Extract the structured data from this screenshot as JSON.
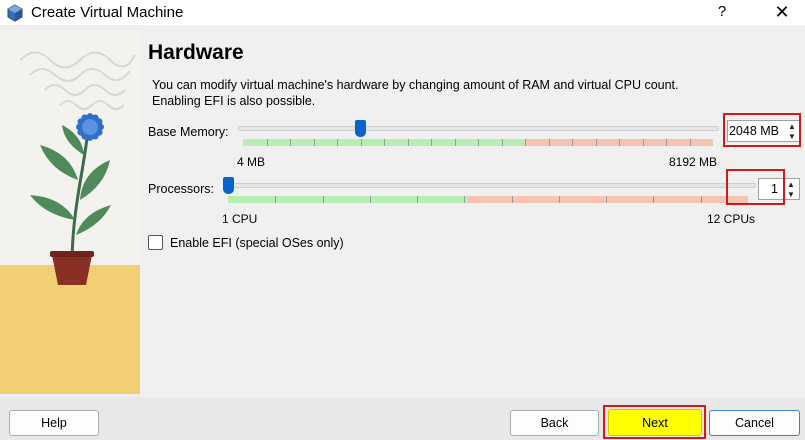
{
  "window": {
    "title": "Create Virtual Machine",
    "help_glyph": "?",
    "close_glyph": "✕"
  },
  "page": {
    "heading": "Hardware",
    "description_line1": "You can modify virtual machine's hardware by changing amount of RAM and virtual CPU count.",
    "description_line2": "Enabling EFI is also possible."
  },
  "memory": {
    "label": "Base Memory:",
    "value": "2048 MB",
    "min_label": "4 MB",
    "max_label": "8192 MB",
    "value_mb": 2048,
    "min_mb": 4,
    "max_mb": 8192,
    "recommended_max_fraction": 0.6
  },
  "processors": {
    "label": "Processors:",
    "value": "1",
    "min_label": "1 CPU",
    "max_label": "12 CPUs",
    "value_count": 1,
    "min_count": 1,
    "max_count": 12,
    "recommended_max_fraction": 0.46
  },
  "efi": {
    "label": "Enable EFI (special OSes only)",
    "checked": false
  },
  "buttons": {
    "help": "Help",
    "back": "Back",
    "next": "Next",
    "cancel": "Cancel"
  },
  "colors": {
    "accent": "#0a64c8",
    "scale_ok": "#b7efb2",
    "scale_bad": "#f6c4b0",
    "highlight": "#d31a1a",
    "next_button": "#ffff00"
  },
  "icons": {
    "app": "virtualbox-cube-icon",
    "spin_up": "▲",
    "spin_down": "▼"
  }
}
